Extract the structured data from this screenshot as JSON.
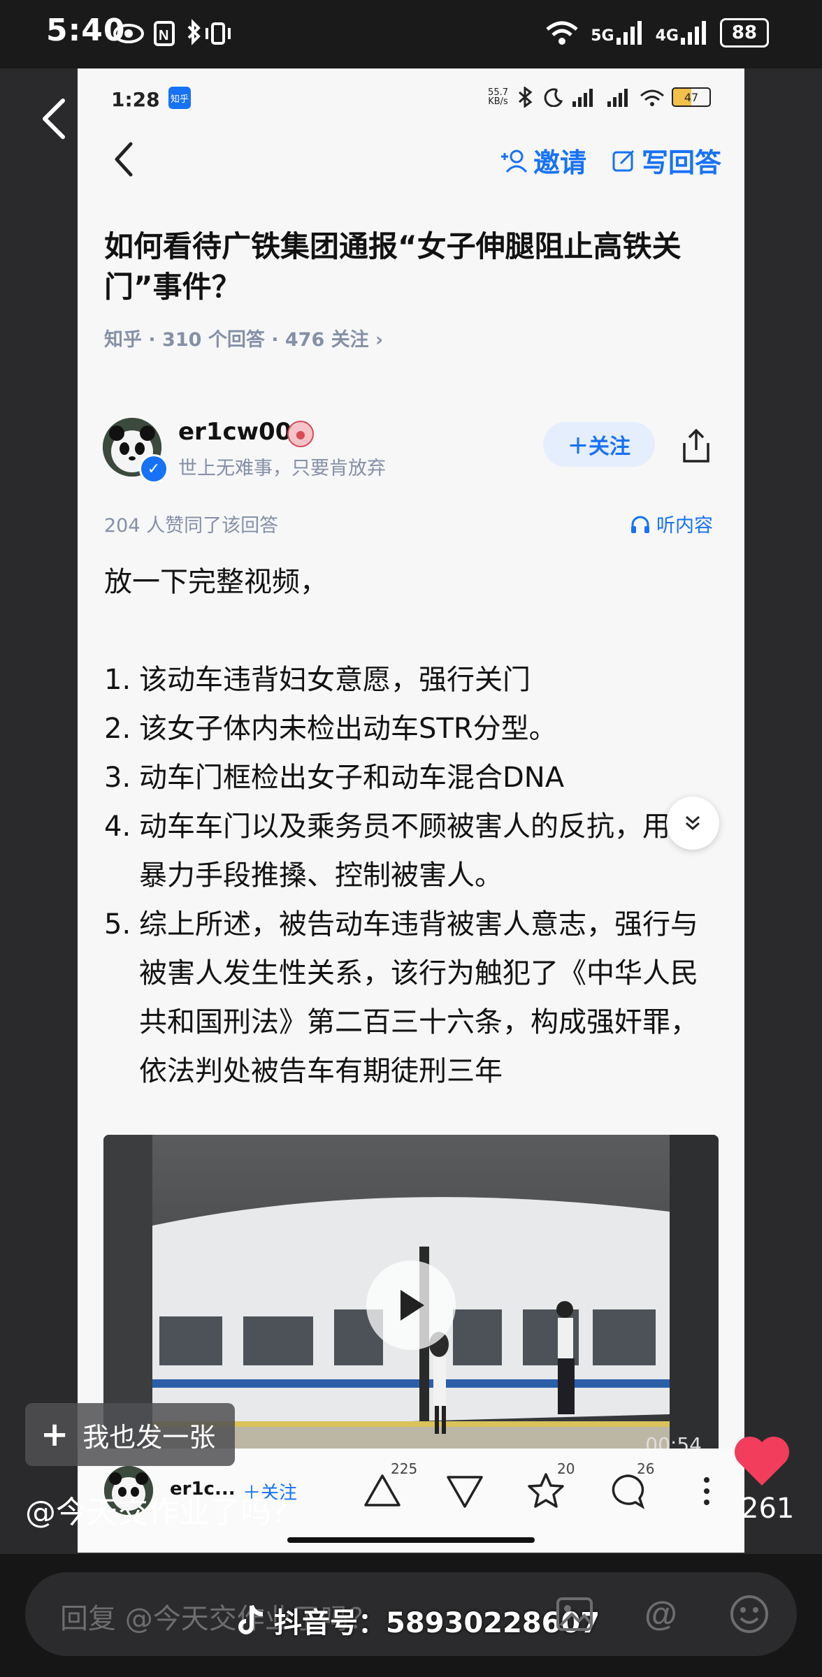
{
  "outer_status": {
    "time": "5:40",
    "network": "5G",
    "network2": "4G",
    "battery": "88"
  },
  "inner_status": {
    "time": "1:28",
    "app_badge": "知乎",
    "speed": "55.7\nKB/s",
    "battery": "47"
  },
  "header": {
    "invite_label": "邀请",
    "write_label": "写回答"
  },
  "question": {
    "title": "如何看待广铁集团通报“女子伸腿阻止高铁关门”事件？",
    "meta": "知乎 · 310 个回答 · 476 关注 ›"
  },
  "author": {
    "name": "er1cw00",
    "bio": "世上无难事，只要肯放弃",
    "follow_label": "＋关注"
  },
  "answer": {
    "agree_text": "204 人赞同了该回答",
    "listen_label": "听内容",
    "intro": "放一下完整视频，",
    "items": [
      {
        "num": "1.",
        "text": "该动车违背妇女意愿，强行关门"
      },
      {
        "num": "2.",
        "text": "该女子体内未检出动车STR分型。"
      },
      {
        "num": "3.",
        "text": "动车门框检出女子和动车混合DNA"
      },
      {
        "num": "4.",
        "text": "动车车门以及乘务员不顾被害人的反抗，用暴力手段推搡、控制被害人。"
      },
      {
        "num": "5.",
        "text": "综上所述，被告动车违背被害人意志，强行与被害人发生性关系，该行为触犯了《中华人民共和国刑法》第二百三十六条，构成强奸罪，依法判处被告车有期徒刑三年"
      }
    ]
  },
  "video": {
    "duration": "00:54"
  },
  "card_bottom": {
    "name": "er1c...",
    "follow": "＋关注",
    "up_count": "225",
    "star_count": "20",
    "comment_count": "26"
  },
  "overlay": {
    "post_label": "我也发一张",
    "account": "@今天交作业了吗？",
    "likes": "261"
  },
  "comment": {
    "placeholder": "回复 @今天交作业了吗？",
    "watermark": "抖音号：58930228607"
  }
}
